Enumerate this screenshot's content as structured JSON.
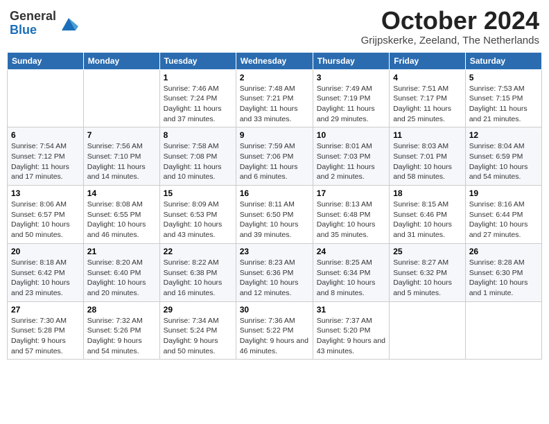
{
  "header": {
    "logo_general": "General",
    "logo_blue": "Blue",
    "month_title": "October 2024",
    "location": "Grijpskerke, Zeeland, The Netherlands"
  },
  "weekdays": [
    "Sunday",
    "Monday",
    "Tuesday",
    "Wednesday",
    "Thursday",
    "Friday",
    "Saturday"
  ],
  "weeks": [
    [
      {
        "day": "",
        "sunrise": "",
        "sunset": "",
        "daylight": ""
      },
      {
        "day": "",
        "sunrise": "",
        "sunset": "",
        "daylight": ""
      },
      {
        "day": "1",
        "sunrise": "Sunrise: 7:46 AM",
        "sunset": "Sunset: 7:24 PM",
        "daylight": "Daylight: 11 hours and 37 minutes."
      },
      {
        "day": "2",
        "sunrise": "Sunrise: 7:48 AM",
        "sunset": "Sunset: 7:21 PM",
        "daylight": "Daylight: 11 hours and 33 minutes."
      },
      {
        "day": "3",
        "sunrise": "Sunrise: 7:49 AM",
        "sunset": "Sunset: 7:19 PM",
        "daylight": "Daylight: 11 hours and 29 minutes."
      },
      {
        "day": "4",
        "sunrise": "Sunrise: 7:51 AM",
        "sunset": "Sunset: 7:17 PM",
        "daylight": "Daylight: 11 hours and 25 minutes."
      },
      {
        "day": "5",
        "sunrise": "Sunrise: 7:53 AM",
        "sunset": "Sunset: 7:15 PM",
        "daylight": "Daylight: 11 hours and 21 minutes."
      }
    ],
    [
      {
        "day": "6",
        "sunrise": "Sunrise: 7:54 AM",
        "sunset": "Sunset: 7:12 PM",
        "daylight": "Daylight: 11 hours and 17 minutes."
      },
      {
        "day": "7",
        "sunrise": "Sunrise: 7:56 AM",
        "sunset": "Sunset: 7:10 PM",
        "daylight": "Daylight: 11 hours and 14 minutes."
      },
      {
        "day": "8",
        "sunrise": "Sunrise: 7:58 AM",
        "sunset": "Sunset: 7:08 PM",
        "daylight": "Daylight: 11 hours and 10 minutes."
      },
      {
        "day": "9",
        "sunrise": "Sunrise: 7:59 AM",
        "sunset": "Sunset: 7:06 PM",
        "daylight": "Daylight: 11 hours and 6 minutes."
      },
      {
        "day": "10",
        "sunrise": "Sunrise: 8:01 AM",
        "sunset": "Sunset: 7:03 PM",
        "daylight": "Daylight: 11 hours and 2 minutes."
      },
      {
        "day": "11",
        "sunrise": "Sunrise: 8:03 AM",
        "sunset": "Sunset: 7:01 PM",
        "daylight": "Daylight: 10 hours and 58 minutes."
      },
      {
        "day": "12",
        "sunrise": "Sunrise: 8:04 AM",
        "sunset": "Sunset: 6:59 PM",
        "daylight": "Daylight: 10 hours and 54 minutes."
      }
    ],
    [
      {
        "day": "13",
        "sunrise": "Sunrise: 8:06 AM",
        "sunset": "Sunset: 6:57 PM",
        "daylight": "Daylight: 10 hours and 50 minutes."
      },
      {
        "day": "14",
        "sunrise": "Sunrise: 8:08 AM",
        "sunset": "Sunset: 6:55 PM",
        "daylight": "Daylight: 10 hours and 46 minutes."
      },
      {
        "day": "15",
        "sunrise": "Sunrise: 8:09 AM",
        "sunset": "Sunset: 6:53 PM",
        "daylight": "Daylight: 10 hours and 43 minutes."
      },
      {
        "day": "16",
        "sunrise": "Sunrise: 8:11 AM",
        "sunset": "Sunset: 6:50 PM",
        "daylight": "Daylight: 10 hours and 39 minutes."
      },
      {
        "day": "17",
        "sunrise": "Sunrise: 8:13 AM",
        "sunset": "Sunset: 6:48 PM",
        "daylight": "Daylight: 10 hours and 35 minutes."
      },
      {
        "day": "18",
        "sunrise": "Sunrise: 8:15 AM",
        "sunset": "Sunset: 6:46 PM",
        "daylight": "Daylight: 10 hours and 31 minutes."
      },
      {
        "day": "19",
        "sunrise": "Sunrise: 8:16 AM",
        "sunset": "Sunset: 6:44 PM",
        "daylight": "Daylight: 10 hours and 27 minutes."
      }
    ],
    [
      {
        "day": "20",
        "sunrise": "Sunrise: 8:18 AM",
        "sunset": "Sunset: 6:42 PM",
        "daylight": "Daylight: 10 hours and 23 minutes."
      },
      {
        "day": "21",
        "sunrise": "Sunrise: 8:20 AM",
        "sunset": "Sunset: 6:40 PM",
        "daylight": "Daylight: 10 hours and 20 minutes."
      },
      {
        "day": "22",
        "sunrise": "Sunrise: 8:22 AM",
        "sunset": "Sunset: 6:38 PM",
        "daylight": "Daylight: 10 hours and 16 minutes."
      },
      {
        "day": "23",
        "sunrise": "Sunrise: 8:23 AM",
        "sunset": "Sunset: 6:36 PM",
        "daylight": "Daylight: 10 hours and 12 minutes."
      },
      {
        "day": "24",
        "sunrise": "Sunrise: 8:25 AM",
        "sunset": "Sunset: 6:34 PM",
        "daylight": "Daylight: 10 hours and 8 minutes."
      },
      {
        "day": "25",
        "sunrise": "Sunrise: 8:27 AM",
        "sunset": "Sunset: 6:32 PM",
        "daylight": "Daylight: 10 hours and 5 minutes."
      },
      {
        "day": "26",
        "sunrise": "Sunrise: 8:28 AM",
        "sunset": "Sunset: 6:30 PM",
        "daylight": "Daylight: 10 hours and 1 minute."
      }
    ],
    [
      {
        "day": "27",
        "sunrise": "Sunrise: 7:30 AM",
        "sunset": "Sunset: 5:28 PM",
        "daylight": "Daylight: 9 hours and 57 minutes."
      },
      {
        "day": "28",
        "sunrise": "Sunrise: 7:32 AM",
        "sunset": "Sunset: 5:26 PM",
        "daylight": "Daylight: 9 hours and 54 minutes."
      },
      {
        "day": "29",
        "sunrise": "Sunrise: 7:34 AM",
        "sunset": "Sunset: 5:24 PM",
        "daylight": "Daylight: 9 hours and 50 minutes."
      },
      {
        "day": "30",
        "sunrise": "Sunrise: 7:36 AM",
        "sunset": "Sunset: 5:22 PM",
        "daylight": "Daylight: 9 hours and 46 minutes."
      },
      {
        "day": "31",
        "sunrise": "Sunrise: 7:37 AM",
        "sunset": "Sunset: 5:20 PM",
        "daylight": "Daylight: 9 hours and 43 minutes."
      },
      {
        "day": "",
        "sunrise": "",
        "sunset": "",
        "daylight": ""
      },
      {
        "day": "",
        "sunrise": "",
        "sunset": "",
        "daylight": ""
      }
    ]
  ]
}
